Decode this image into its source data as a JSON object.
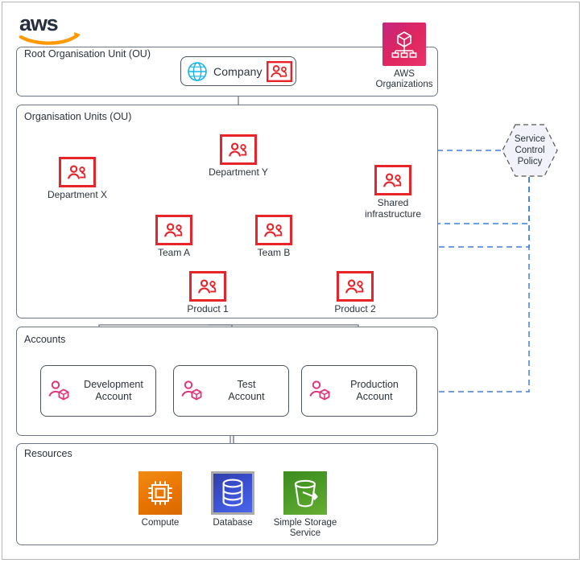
{
  "brand": {
    "logo_text": "aws",
    "logo_color": "#ff9900"
  },
  "sections": {
    "root_ou": {
      "title": "Root Organisation Unit (OU)"
    },
    "ous": {
      "title": "Organisation Units (OU)"
    },
    "accounts": {
      "title": "Accounts"
    },
    "resources": {
      "title": "Resources"
    }
  },
  "company": {
    "label": "Company",
    "globe_icon": "globe-icon",
    "ou_icon": "organisation-unit-icon"
  },
  "service": {
    "label": "AWS\nOrganizations",
    "icon": "aws-organizations-icon",
    "color": "#e0275e"
  },
  "scp": {
    "label": "Service\nControl\nPolicy",
    "shape": "hexagon",
    "fill": "#f2f2fa",
    "stroke": "#555555",
    "line_color": "#3f7fd6"
  },
  "ou_nodes": [
    {
      "id": "department-x",
      "label": "Department X",
      "icon": "organisation-unit-icon"
    },
    {
      "id": "department-y",
      "label": "Department Y",
      "icon": "organisation-unit-icon"
    },
    {
      "id": "shared-infrastructure",
      "label": "Shared\ninfrastructure",
      "icon": "organisation-unit-icon"
    },
    {
      "id": "team-a",
      "label": "Team A",
      "icon": "organisation-unit-icon"
    },
    {
      "id": "team-b",
      "label": "Team B",
      "icon": "organisation-unit-icon"
    },
    {
      "id": "product-1",
      "label": "Product 1",
      "icon": "organisation-unit-icon"
    },
    {
      "id": "product-2",
      "label": "Product 2",
      "icon": "organisation-unit-icon"
    }
  ],
  "accounts": [
    {
      "id": "development-account",
      "label": "Development\nAccount",
      "icon": "aws-account-icon"
    },
    {
      "id": "test-account",
      "label": "Test\nAccount",
      "icon": "aws-account-icon"
    },
    {
      "id": "production-account",
      "label": "Production\nAccount",
      "icon": "aws-account-icon"
    }
  ],
  "resources": [
    {
      "id": "compute",
      "label": "Compute",
      "icon": "cpu-chip-icon",
      "color": "#ea7600"
    },
    {
      "id": "database",
      "label": "Database",
      "icon": "database-cylinder-icon",
      "color": "#3a4fd0"
    },
    {
      "id": "simple-storage-service",
      "label": "Simple Storage\nService",
      "icon": "s3-bucket-icon",
      "color": "#4f9e27"
    }
  ],
  "colors": {
    "ou_red": "#e8242a",
    "account_pink": "#e0357a",
    "globe_cyan": "#18b4e9",
    "connector": "#4a5564",
    "scp_blue": "#3f7fd6"
  }
}
